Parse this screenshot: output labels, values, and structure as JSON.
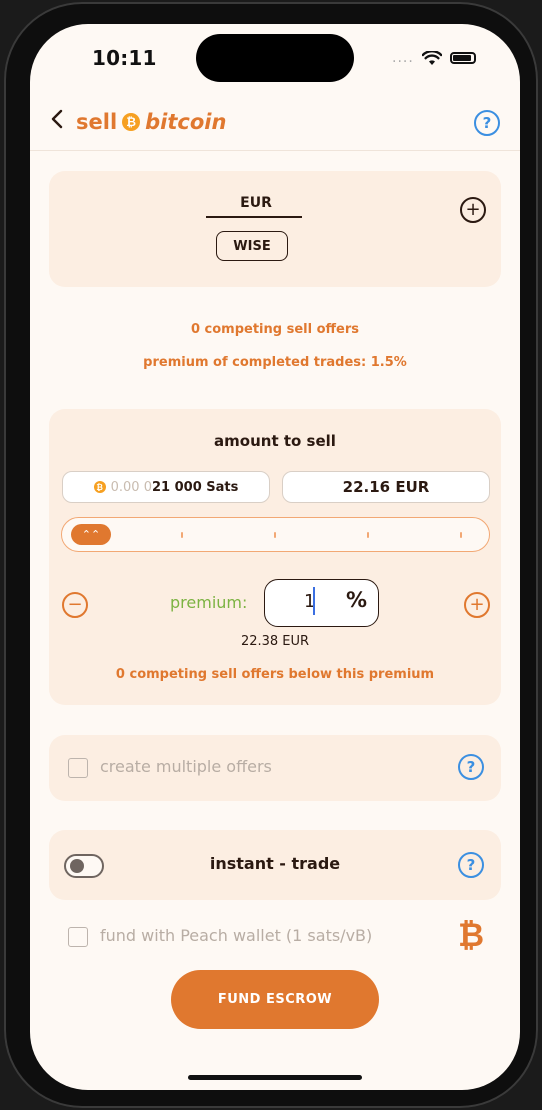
{
  "status_bar": {
    "time": "10:11",
    "dots": "...."
  },
  "header": {
    "back_icon": "chevron-left-icon",
    "title_sell": "sell",
    "title_coin": "₿",
    "title_bitcoin": "bitcoin",
    "help": "?"
  },
  "payment_card": {
    "currency": "EUR",
    "method": "WISE",
    "add": "+"
  },
  "market": {
    "competing_offers": "0 competing sell offers",
    "premium_completed": "premium of completed trades: 1.5%"
  },
  "amount": {
    "title": "amount to sell",
    "sats_prefix": "0.00 0",
    "sats_value": "21 000 Sats",
    "eur_value": "22.16 EUR",
    "slider_icon": "chevrons-up-icon",
    "slider_handle_glyph": "⌃⌃",
    "slider_position": 0.0
  },
  "premium": {
    "label": "premium:",
    "value": "1",
    "unit": "%",
    "minus": "−",
    "plus": "+",
    "eur_equivalent": "22.38 EUR",
    "competing_below": "0 competing sell offers below this premium"
  },
  "multiple_offers": {
    "label": "create multiple offers",
    "checked": false,
    "help": "?"
  },
  "instant_trade": {
    "label": "instant - trade",
    "enabled": false,
    "help": "?"
  },
  "fund_wallet": {
    "label": "fund with Peach wallet (1 sats/vB)",
    "checked": false,
    "symbol": "₿"
  },
  "action": {
    "fund_escrow": "FUND ESCROW"
  },
  "colors": {
    "accent": "#E0782F",
    "help_blue": "#3B8FE1",
    "premium_green": "#7CB342",
    "card_bg": "#FCEEE2",
    "page_bg": "#FEF9F4"
  }
}
